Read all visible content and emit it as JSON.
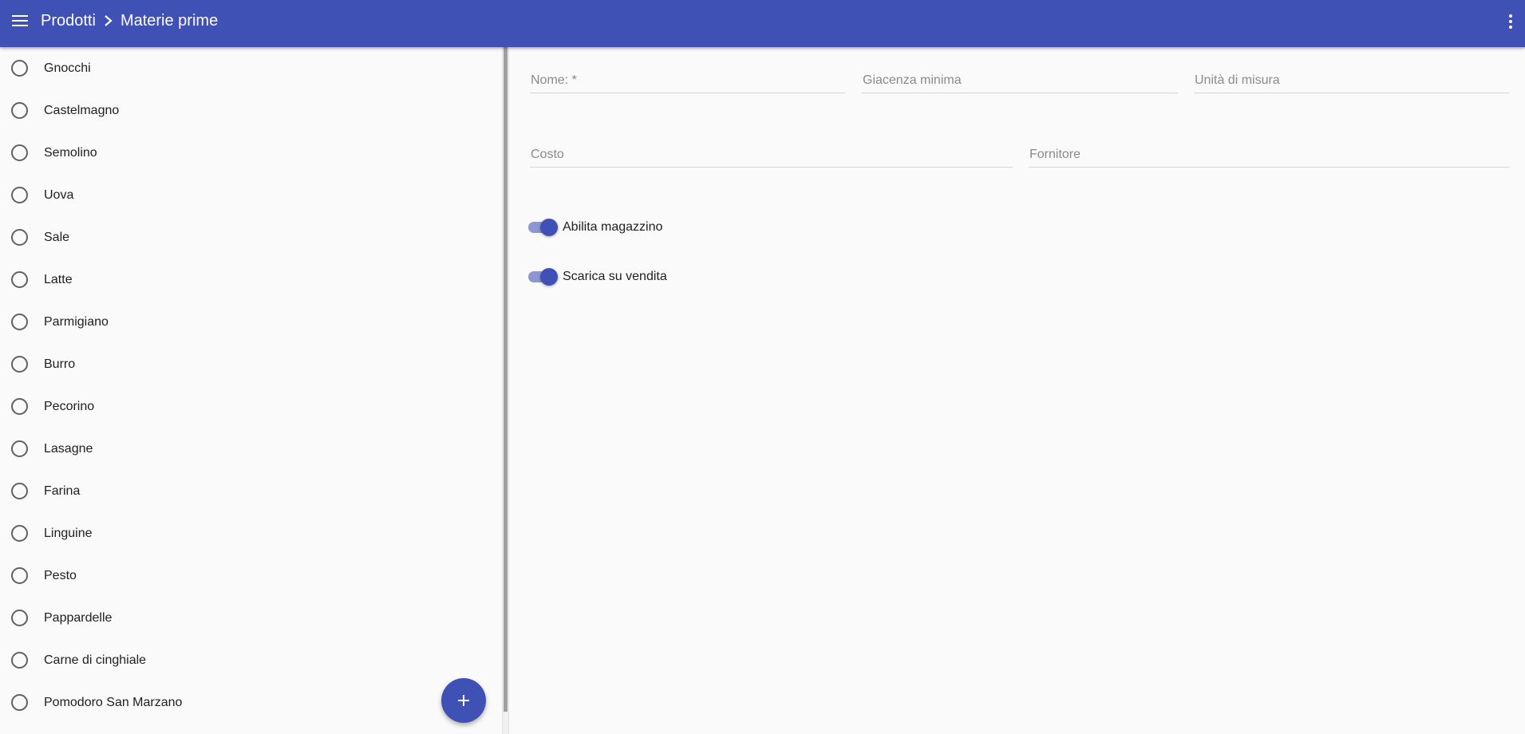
{
  "header": {
    "breadcrumb": [
      "Prodotti",
      "Materie prime"
    ],
    "background": "#3f51b5",
    "menu_icon": "hamburger-menu-icon",
    "more_icon": "more-vertical-icon"
  },
  "list": {
    "items": [
      {
        "label": "Gnocchi"
      },
      {
        "label": "Castelmagno"
      },
      {
        "label": "Semolino"
      },
      {
        "label": "Uova"
      },
      {
        "label": "Sale"
      },
      {
        "label": "Latte"
      },
      {
        "label": "Parmigiano"
      },
      {
        "label": "Burro"
      },
      {
        "label": "Pecorino"
      },
      {
        "label": "Lasagne"
      },
      {
        "label": "Farina"
      },
      {
        "label": "Linguine"
      },
      {
        "label": "Pesto"
      },
      {
        "label": "Pappardelle"
      },
      {
        "label": "Carne di cinghiale"
      },
      {
        "label": "Pomodoro San Marzano"
      }
    ],
    "add_button_icon": "plus-icon"
  },
  "form": {
    "nome": {
      "placeholder": "Nome: *",
      "value": ""
    },
    "giacenza_minima": {
      "placeholder": "Giacenza minima",
      "value": ""
    },
    "unita_di_misura": {
      "placeholder": "Unità di misura",
      "value": ""
    },
    "costo": {
      "placeholder": "Costo",
      "value": ""
    },
    "fornitore": {
      "placeholder": "Fornitore",
      "value": ""
    },
    "toggles": [
      {
        "label": "Abilita magazzino",
        "checked": true
      },
      {
        "label": "Scarica su vendita",
        "checked": true
      }
    ]
  },
  "colors": {
    "primary": "#3f51b5",
    "toggle_track": "#8c96d2",
    "background": "#fafafa"
  }
}
